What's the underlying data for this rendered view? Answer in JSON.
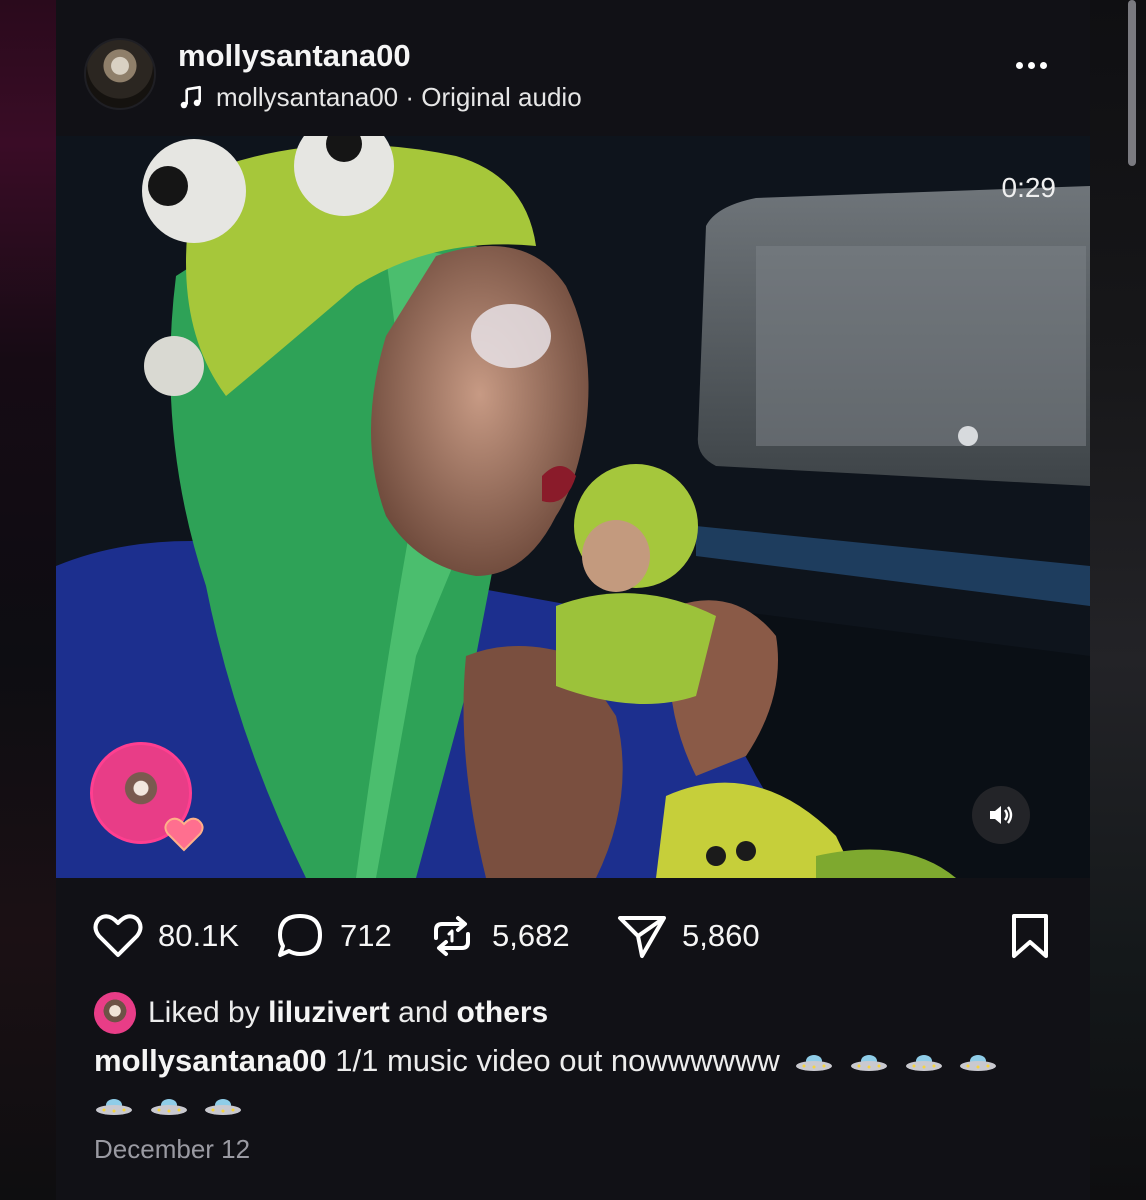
{
  "header": {
    "username": "mollysantana00",
    "audio_text": "mollysantana00 · Original audio"
  },
  "video": {
    "timer": "0:29"
  },
  "actions": {
    "likes": "80.1K",
    "comments": "712",
    "reposts": "5,682",
    "shares": "5,860"
  },
  "liked_by": {
    "prefix": "Liked by",
    "user": "liluzivert",
    "middle": "and",
    "suffix": "others"
  },
  "caption": {
    "username": "mollysantana00",
    "text": "1/1 music video out nowwwwww"
  },
  "date": "December 12",
  "colors": {
    "background": "#111116",
    "accent_pink": "#e83d87",
    "muted_text": "#9a9aa2"
  },
  "icons": [
    "music-note-icon",
    "more-icon",
    "heart-icon",
    "comment-icon",
    "repost-icon",
    "share-icon",
    "bookmark-icon",
    "volume-icon",
    "ufo-emoji"
  ]
}
